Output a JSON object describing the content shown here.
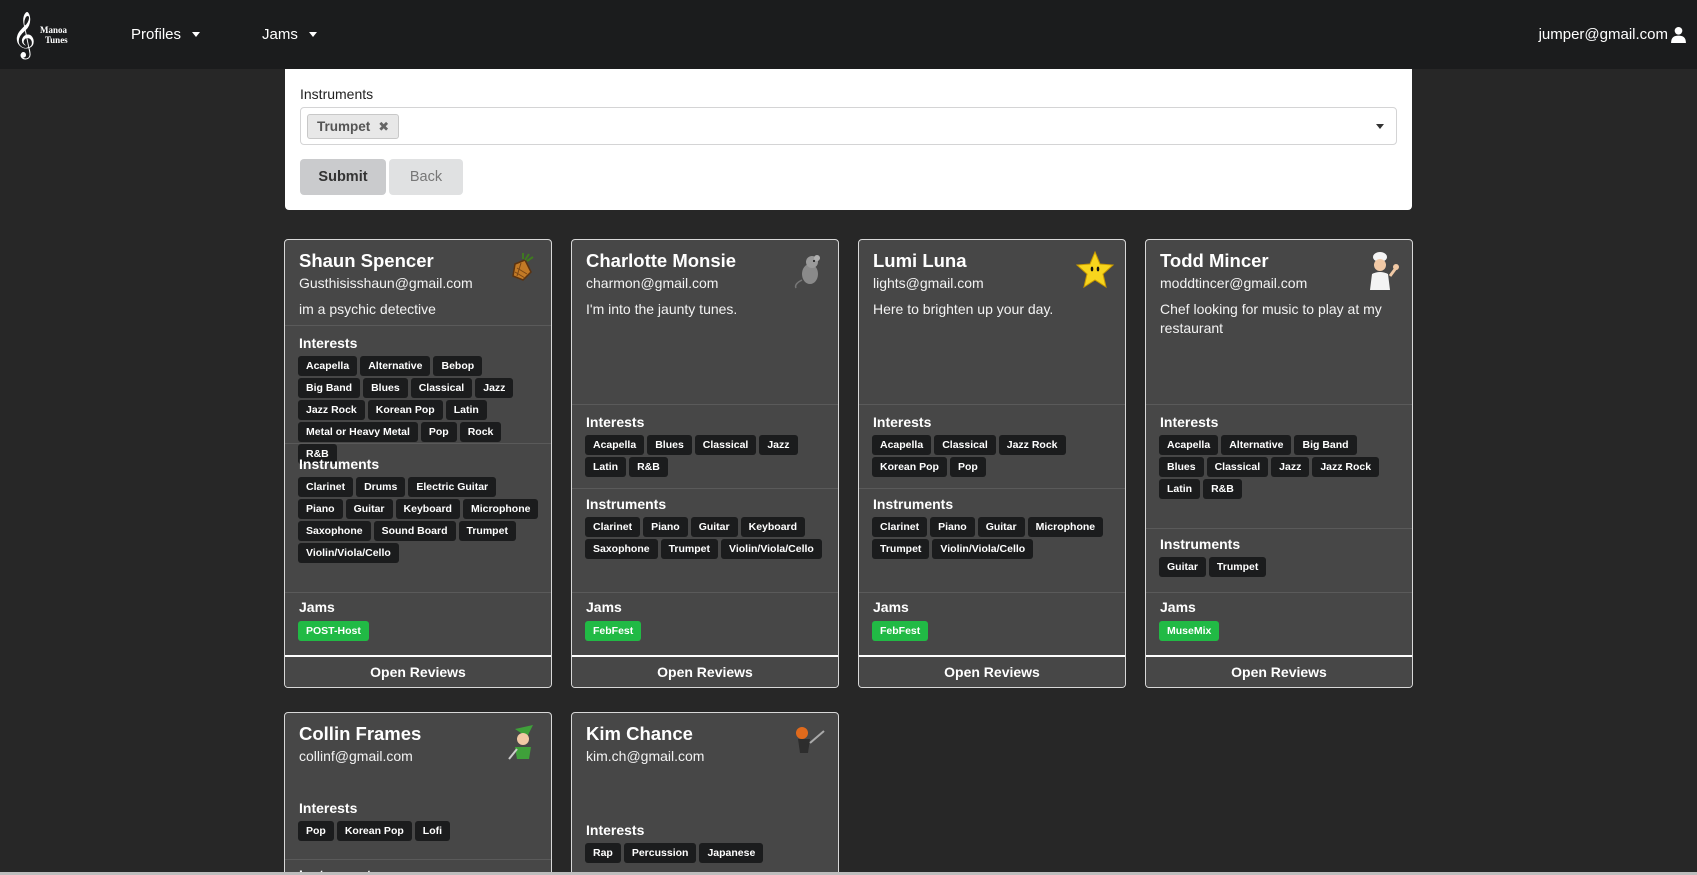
{
  "nav": {
    "logo_text_line1": "Manoa",
    "logo_text_line2": "Tunes",
    "profiles_label": "Profiles",
    "jams_label": "Jams",
    "user_email": "jumper@gmail.com"
  },
  "filter": {
    "label": "Instruments",
    "selected_chip": "Trumpet",
    "chip_remove": "✖",
    "submit_label": "Submit",
    "back_label": "Back"
  },
  "section_titles": {
    "interests": "Interests",
    "instruments": "Instruments",
    "jams": "Jams"
  },
  "open_reviews_label": "Open Reviews",
  "cards": [
    {
      "name": "Shaun Spencer",
      "email": "Gusthisisshaun@gmail.com",
      "bio": "im a psychic detective",
      "avatar": "pineapple-icon",
      "interests": [
        "Acapella",
        "Alternative",
        "Bebop",
        "Big Band",
        "Blues",
        "Classical",
        "Jazz",
        "Jazz Rock",
        "Korean Pop",
        "Latin",
        "Metal or Heavy Metal",
        "Pop",
        "Rock",
        "R&B"
      ],
      "instruments": [
        "Clarinet",
        "Drums",
        "Electric Guitar",
        "Piano",
        "Guitar",
        "Keyboard",
        "Microphone",
        "Saxophone",
        "Sound Board",
        "Trumpet",
        "Violin/Viola/Cello"
      ],
      "jams": [
        "POST-Host"
      ]
    },
    {
      "name": "Charlotte Monsie",
      "email": "charmon@gmail.com",
      "bio": "I'm into the jaunty tunes.",
      "avatar": "rat-icon",
      "interests": [
        "Acapella",
        "Blues",
        "Classical",
        "Jazz",
        "Latin",
        "R&B"
      ],
      "instruments": [
        "Clarinet",
        "Piano",
        "Guitar",
        "Keyboard",
        "Saxophone",
        "Trumpet",
        "Violin/Viola/Cello"
      ],
      "jams": [
        "FebFest"
      ]
    },
    {
      "name": "Lumi Luna",
      "email": "lights@gmail.com",
      "bio": "Here to brighten up your day.",
      "avatar": "star-icon",
      "interests": [
        "Acapella",
        "Classical",
        "Jazz Rock",
        "Korean Pop",
        "Pop"
      ],
      "instruments": [
        "Clarinet",
        "Piano",
        "Guitar",
        "Microphone",
        "Trumpet",
        "Violin/Viola/Cello"
      ],
      "jams": [
        "FebFest"
      ]
    },
    {
      "name": "Todd Mincer",
      "email": "moddtincer@gmail.com",
      "bio": "Chef looking for music to play at my restaurant",
      "avatar": "chef-icon",
      "interests": [
        "Acapella",
        "Alternative",
        "Big Band",
        "Blues",
        "Classical",
        "Jazz",
        "Jazz Rock",
        "Latin",
        "R&B"
      ],
      "instruments": [
        "Guitar",
        "Trumpet"
      ],
      "jams": [
        "MuseMix"
      ]
    },
    {
      "name": "Collin Frames",
      "email": "collinf@gmail.com",
      "bio": "",
      "avatar": "elf-icon",
      "interests": [
        "Pop",
        "Korean Pop",
        "Lofi"
      ],
      "instruments": [],
      "jams": []
    },
    {
      "name": "Kim Chance",
      "email": "kim.ch@gmail.com",
      "bio": "",
      "avatar": "hero-icon",
      "interests": [
        "Rap",
        "Percussion",
        "Japanese"
      ],
      "instruments": [],
      "jams": []
    }
  ],
  "colors": {
    "page_bg": "#272727",
    "card_bg": "#474747",
    "tag_bg": "#1b1c1d",
    "jam_tag_bg": "#21ba45"
  }
}
